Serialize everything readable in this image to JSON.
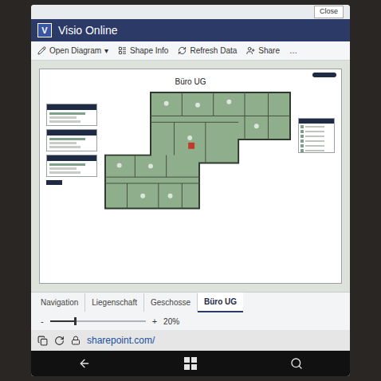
{
  "window": {
    "title": "Visio Online",
    "logo": "V"
  },
  "top_bar": {
    "button": "Close"
  },
  "toolbar": [
    {
      "label": "Open Diagram",
      "caret": "▾"
    },
    {
      "label": "Shape Info",
      "caret": ""
    },
    {
      "label": "Refresh Data",
      "caret": ""
    },
    {
      "label": "Share",
      "caret": ""
    },
    {
      "label": "…",
      "caret": ""
    }
  ],
  "diagram": {
    "title": "Büro UG"
  },
  "tabs": [
    {
      "label": "Navigation",
      "selected": false
    },
    {
      "label": "Liegenschaft",
      "selected": false
    },
    {
      "label": "Geschosse",
      "selected": false
    },
    {
      "label": "Büro UG",
      "selected": true
    }
  ],
  "zoom": {
    "minus": "-",
    "plus": "+",
    "level": 0.25,
    "reading": "20%"
  },
  "browser": {
    "address": "sharepoint.com/"
  }
}
